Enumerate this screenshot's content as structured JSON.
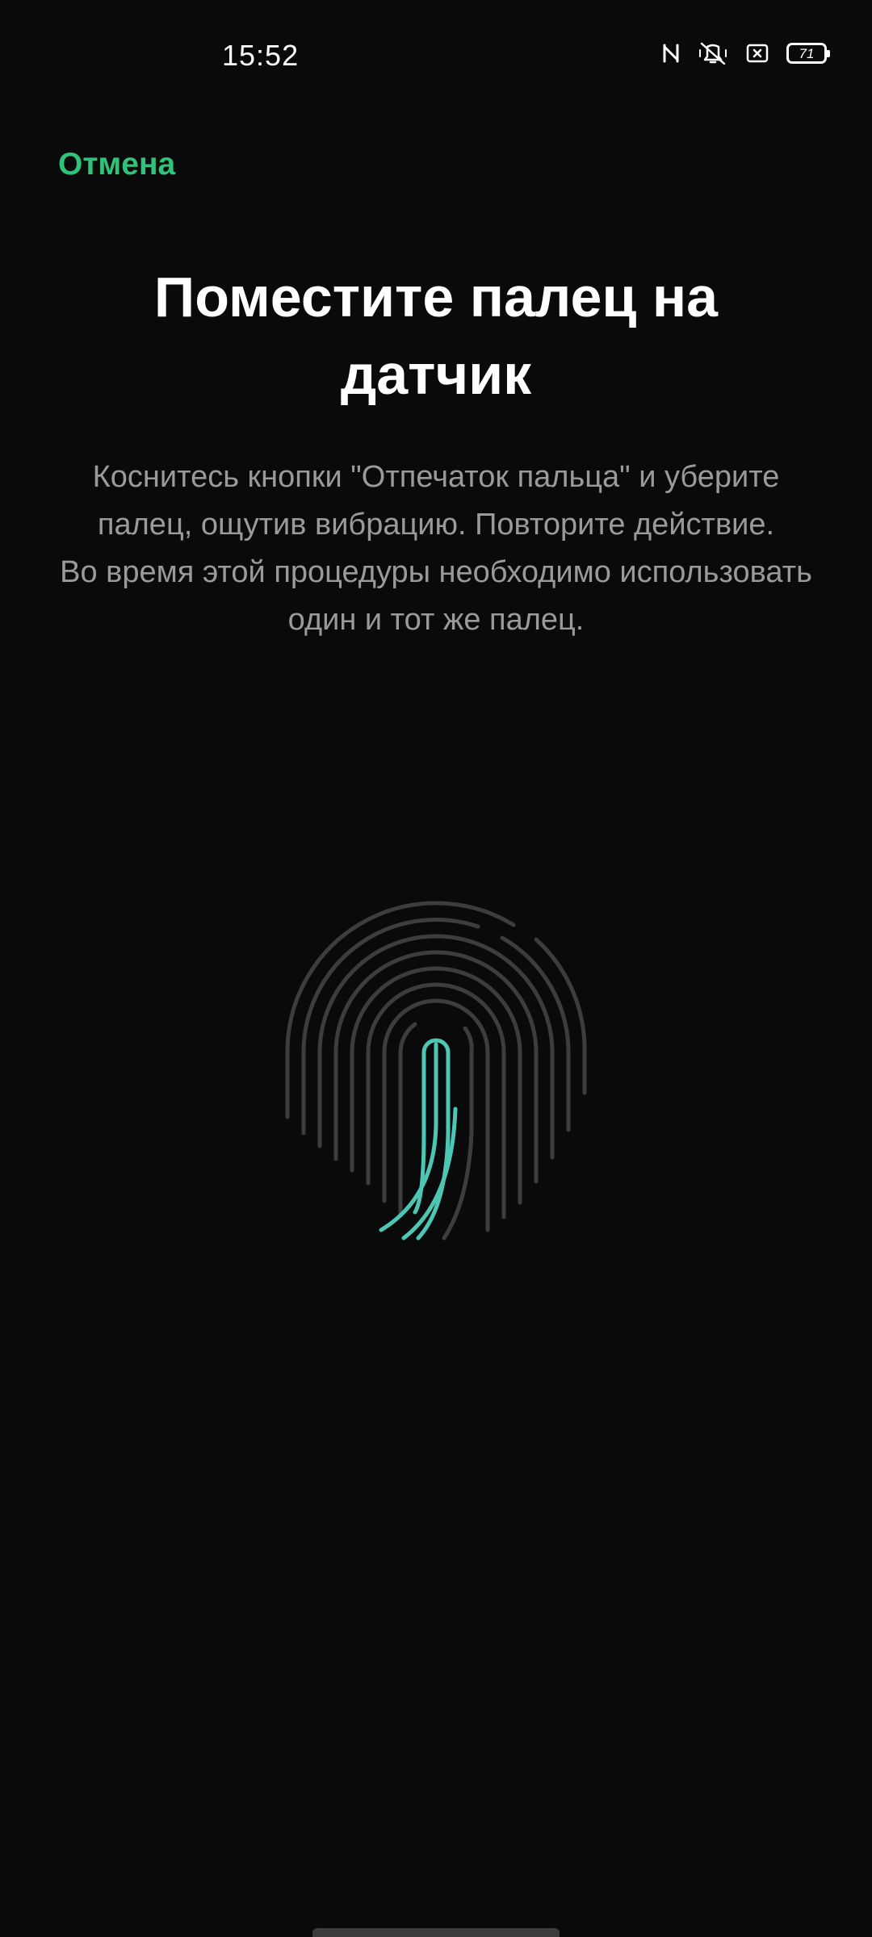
{
  "status_bar": {
    "time": "15:52",
    "battery_level": "71",
    "icons": [
      "nfc-icon",
      "vibrate-muted-icon",
      "screen-record-icon",
      "battery-icon"
    ]
  },
  "header": {
    "cancel_label": "Отмена"
  },
  "main": {
    "title": "Поместите палец на датчик",
    "instruction": "Коснитесь кнопки \"Отпечаток пальца\" и уберите палец, ощутив вибрацию. Повторите действие.",
    "note": "Во время этой процедуры необходимо использовать один и тот же палец."
  },
  "fingerprint": {
    "progress_color": "#4dc7b4",
    "idle_color": "#3d3d3d"
  },
  "colors": {
    "accent": "#2fc27a",
    "background": "#0a0a0a"
  }
}
